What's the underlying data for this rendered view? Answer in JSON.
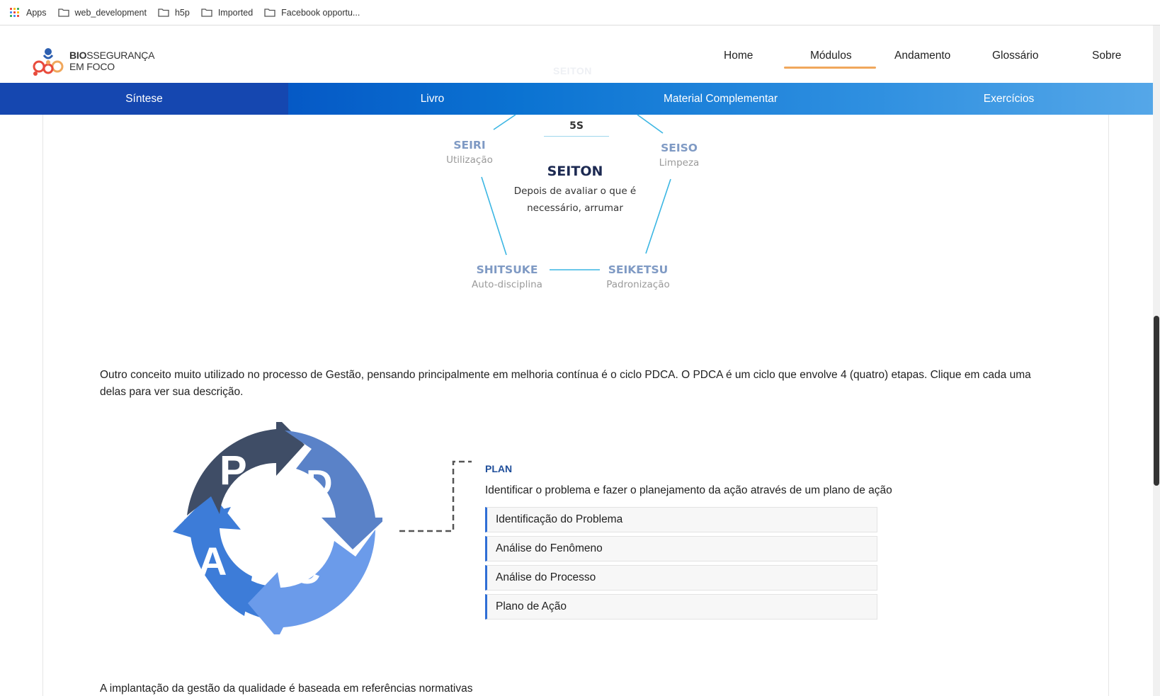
{
  "bookmarks": {
    "apps": "Apps",
    "items": [
      "web_development",
      "h5p",
      "Imported",
      "Facebook opportu..."
    ]
  },
  "header": {
    "logo_bold": "BIO",
    "logo_rest": "SSEGURANÇA",
    "logo_line2": "EM FOCO",
    "nav": [
      "Home",
      "Módulos",
      "Andamento",
      "Glossário",
      "Sobre"
    ],
    "active_nav": "Módulos",
    "ghost_text": "SEITON"
  },
  "tabs": {
    "items": [
      "Síntese",
      "Livro",
      "Material Complementar",
      "Exercícios"
    ],
    "active": "Síntese"
  },
  "five_s": {
    "center_label": "5S",
    "center_title": "SEITON",
    "center_desc": "Depois de avaliar o que é necessário, arrumar",
    "items": [
      {
        "title": "SEIRI",
        "sub": "Utilização"
      },
      {
        "title": "SEISO",
        "sub": "Limpeza"
      },
      {
        "title": "SHITSUKE",
        "sub": "Auto-disciplina"
      },
      {
        "title": "SEIKETSU",
        "sub": "Padronização"
      }
    ]
  },
  "content": {
    "pdca_intro": "Outro conceito muito utilizado no processo de Gestão, pensando principalmente em melhoria contínua é o ciclo PDCA. O PDCA é um ciclo que envolve 4 (quatro) etapas. Clique em cada uma delas para ver sua descrição.",
    "footer_text": "A implantação da gestão da qualidade é baseada em referências normativas"
  },
  "pdca": {
    "letters": [
      "P",
      "D",
      "C",
      "A"
    ],
    "colors": {
      "P": "#3f4d66",
      "D": "#5a82c8",
      "C": "#6b9bea",
      "A": "#3d7cd8"
    },
    "selected_title": "PLAN",
    "selected_desc": "Identificar o problema e fazer o planejamento da ação através de um plano de ação",
    "steps": [
      "Identificação do Problema",
      "Análise do Fenômeno",
      "Análise do Processo",
      "Plano de Ação"
    ]
  }
}
